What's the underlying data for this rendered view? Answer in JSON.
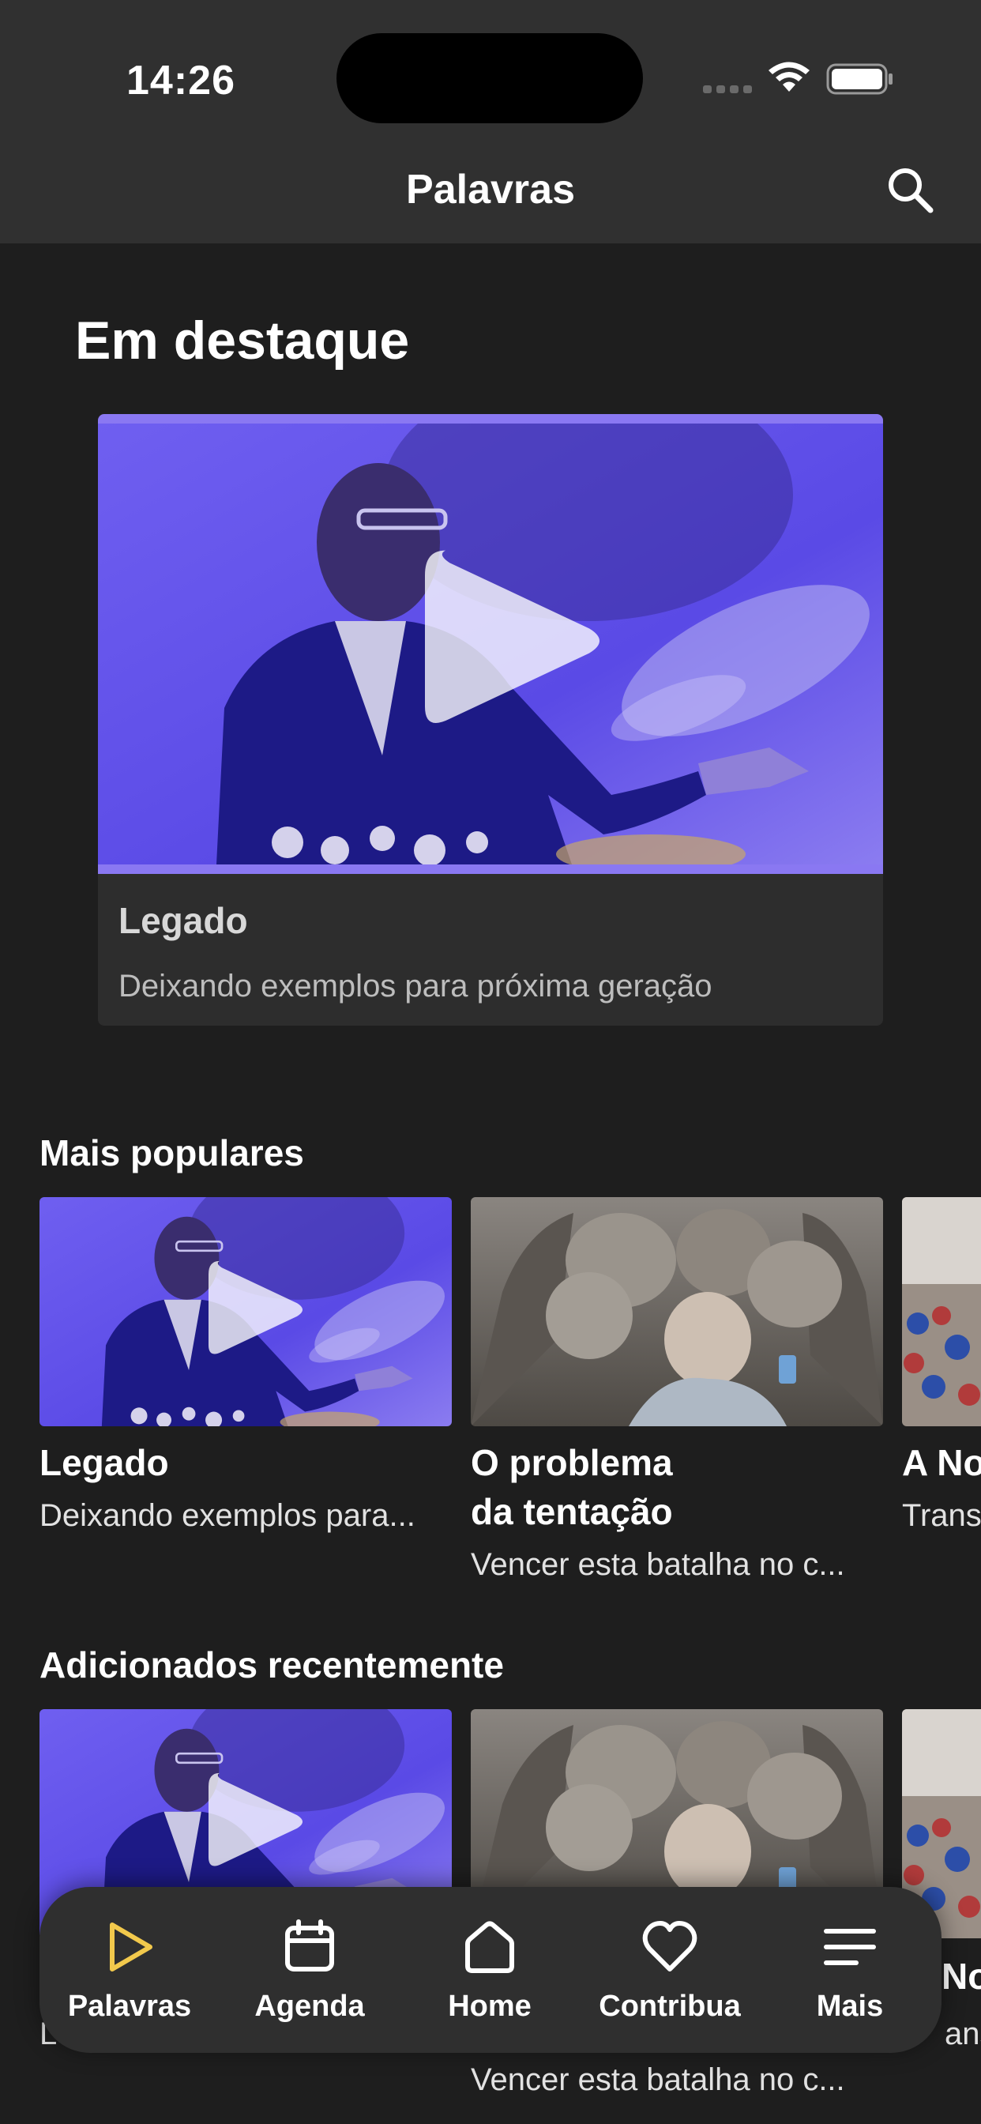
{
  "status": {
    "time": "14:26"
  },
  "nav": {
    "title": "Palavras",
    "search_icon": "search-icon"
  },
  "featured": {
    "section_title": "Em destaque",
    "card": {
      "title": "Legado",
      "subtitle": "Deixando exemplos para próxima geração"
    }
  },
  "popular": {
    "section_title": "Mais populares",
    "items": [
      {
        "title": "Legado",
        "subtitle": "Deixando exemplos para..."
      },
      {
        "title_line1": "O problema",
        "title_line2": "da tentação",
        "subtitle": "Vencer esta batalha no c..."
      },
      {
        "title": "A No",
        "subtitle": "Trans"
      }
    ]
  },
  "recent": {
    "section_title": "Adicionados recentemente",
    "items": [
      {
        "subtitle_peek": "L"
      },
      {
        "subtitle": "Vencer esta batalha no c..."
      },
      {
        "title": "No",
        "subtitle": "ans"
      }
    ]
  },
  "tabbar": {
    "items": [
      {
        "label": "Palavras",
        "icon": "play-icon",
        "active": true
      },
      {
        "label": "Agenda",
        "icon": "calendar-icon",
        "active": false
      },
      {
        "label": "Home",
        "icon": "home-icon",
        "active": false
      },
      {
        "label": "Contribua",
        "icon": "heart-icon",
        "active": false
      },
      {
        "label": "Mais",
        "icon": "menu-icon",
        "active": false
      }
    ],
    "active_color": "#f2c94c"
  },
  "colors": {
    "background": "#1e1e1e",
    "topbar": "#303030",
    "card": "#2d2d2d",
    "accent_purple": "#8a78f2"
  }
}
